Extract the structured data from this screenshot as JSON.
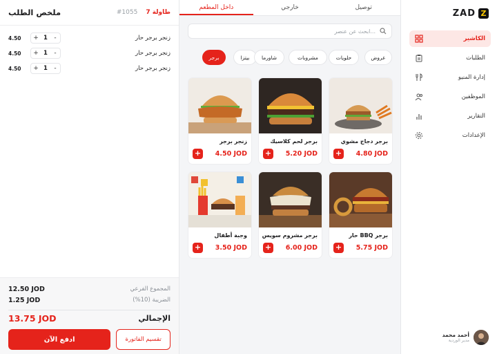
{
  "order": {
    "title": "ملخص الطلب",
    "order_number": "#1055",
    "table": "طاولة 7",
    "items": [
      {
        "name": "زنجر برجر حار",
        "qty": "1",
        "price": "4.50"
      },
      {
        "name": "زنجر برجر حار",
        "qty": "1",
        "price": "4.50"
      },
      {
        "name": "زنجر برجر حار",
        "qty": "1",
        "price": "4.50"
      }
    ],
    "subtotal_label": "المجموع الفرعي",
    "subtotal": "12.50 JOD",
    "tax_label": "الضريبة (10%)",
    "tax": "1.25 JOD",
    "total_label": "الإجمالي",
    "total": "13.75 JOD",
    "pay_label": "ادفع الآن",
    "split_label": "تقسيم الفاتورة"
  },
  "menu": {
    "tabs": [
      "داخل المطعم",
      "خارجي",
      "توصيل"
    ],
    "active_tab": 0,
    "search_placeholder": "ابحث عن عنصر...",
    "categories": [
      "برجر",
      "بيتزا",
      "شاورما",
      "مشروبات",
      "حلويات",
      "عروض"
    ],
    "active_category": 0,
    "products": [
      {
        "name": "برجر دجاج مشوي",
        "price": "4.80 JOD"
      },
      {
        "name": "برجر لحم كلاسيك",
        "price": "5.20 JOD"
      },
      {
        "name": "زنجر برجر",
        "price": "4.50 JOD"
      },
      {
        "name": "برجر BBQ حار",
        "price": "5.75 JOD"
      },
      {
        "name": "برجر مشروم سويس",
        "price": "6.00 JOD"
      },
      {
        "name": "وجبة أطفال",
        "price": "3.50 JOD"
      }
    ],
    "add_symbol": "+"
  },
  "sidebar": {
    "brand": "ZAD",
    "brand_mark": "Z",
    "items": [
      {
        "label": "الكاشير",
        "icon": "grid-icon",
        "active": true
      },
      {
        "label": "الطلبات",
        "icon": "clipboard-icon"
      },
      {
        "label": "إدارة المنيو",
        "icon": "utensils-icon"
      },
      {
        "label": "الموظفين",
        "icon": "users-icon"
      },
      {
        "label": "التقارير",
        "icon": "bar-chart-icon"
      },
      {
        "label": "الإعدادات",
        "icon": "gear-icon"
      }
    ],
    "user": {
      "name": "أحمد محمد",
      "role": "مدير الوردية"
    }
  },
  "colors": {
    "accent": "#e5231b",
    "accent_soft": "#fde7e5",
    "background": "#f4f5f7"
  }
}
